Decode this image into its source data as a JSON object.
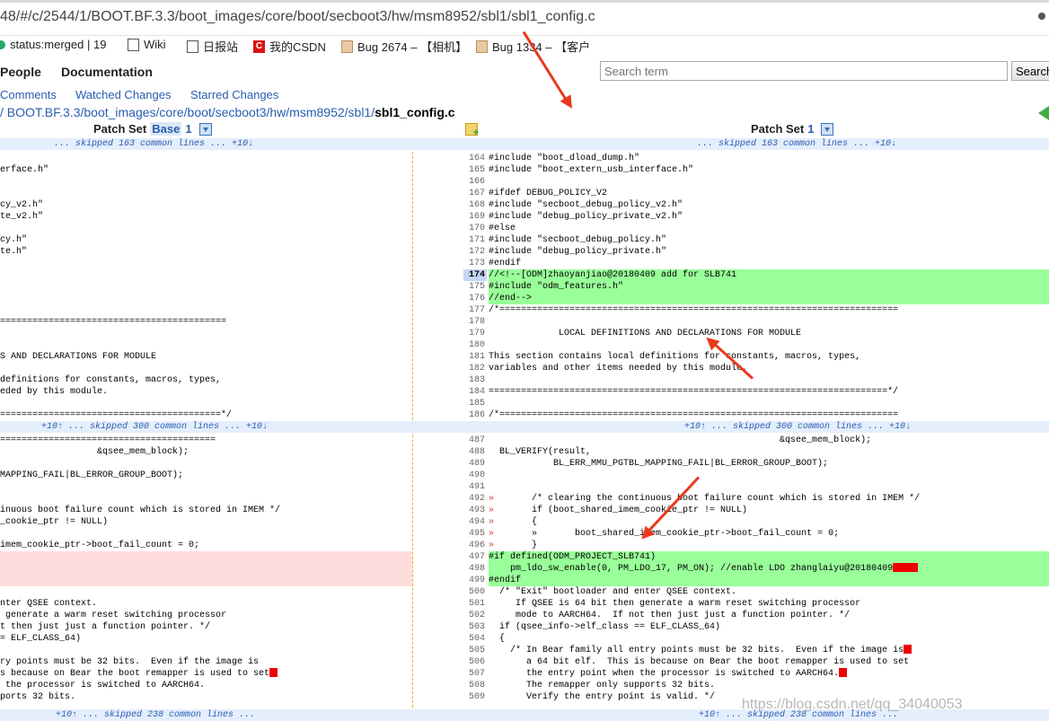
{
  "address_bar": {
    "url": "48/#/c/2544/1/BOOT.BF.3.3/boot_images/core/boot/secboot3/hw/msm8952/sbl1/sbl1_config.c"
  },
  "bookmarks": [
    {
      "label": "status:merged | 19",
      "icon": "gerrit-icon"
    },
    {
      "label": "Wiki",
      "icon": "page-icon"
    },
    {
      "label": "日报站",
      "icon": "page-icon"
    },
    {
      "label": "我的CSDN",
      "icon": "csdn-icon"
    },
    {
      "label": "Bug 2674 – 【相机】",
      "icon": "bugzilla-icon"
    },
    {
      "label": "Bug 1334 – 【客户",
      "icon": "bugzilla-icon"
    }
  ],
  "header": {
    "nav": [
      "People",
      "Documentation"
    ],
    "search_placeholder": "Search term",
    "search_button": "Search",
    "subnav": [
      "Comments",
      "Watched Changes",
      "Starred Changes"
    ],
    "path_prefix": "/ BOOT.BF.3.3/boot_images/core/boot/secboot3/hw/msm8952/sbl1/",
    "path_file": "sbl1_config.c"
  },
  "patchsets": {
    "left_label": "Patch Set",
    "left_base": "Base",
    "left_num": "1",
    "right_label": "Patch Set",
    "right_num": "1"
  },
  "skips": [
    {
      "left": "... skipped 163 common lines ... +10↓",
      "right": "... skipped 163 common lines ... +10↓"
    },
    {
      "left": "+10↑ ... skipped 300 common lines ... +10↓",
      "right": "+10↑ ... skipped 300 common lines ... +10↓"
    },
    {
      "left": "+10↑ ... skipped 238 common lines ...",
      "right": "+10↑ ... skipped 238 common lines ..."
    }
  ],
  "left_lines": [
    "",
    "erface.h\"",
    "",
    "",
    "cy_v2.h\"",
    "te_v2.h\"",
    "",
    "cy.h\"",
    "te.h\"",
    "",
    "",
    "",
    "",
    "",
    "==========================================",
    "",
    "",
    "S AND DECLARATIONS FOR MODULE",
    "",
    "definitions for constants, macros, types,",
    "eded by this module.",
    "",
    "=========================================*/",
    "",
    "========================================",
    "                  &qsee_mem_block);",
    "",
    "MAPPING_FAIL|BL_ERROR_GROUP_BOOT);",
    "",
    "",
    "inuous boot failure count which is stored in IMEM */",
    "_cookie_ptr != NULL)",
    "",
    "imem_cookie_ptr->boot_fail_count = 0;",
    "",
    "",
    "",
    "",
    "nter QSEE context.",
    " generate a warm reset switching processor",
    "t then just just a function pointer. */",
    "= ELF_CLASS_64)",
    "",
    "ry points must be 32 bits.  Even if the image is",
    "s because on Bear the boot remapper is used to set",
    " the processor is switched to AARCH64.",
    "ports 32 bits.",
    "t is valid. */"
  ],
  "right_block1": [
    {
      "n": "164",
      "t": "#include \"boot_dload_dump.h\""
    },
    {
      "n": "165",
      "t": "#include \"boot_extern_usb_interface.h\""
    },
    {
      "n": "166",
      "t": ""
    },
    {
      "n": "167",
      "t": "#ifdef DEBUG_POLICY_V2"
    },
    {
      "n": "168",
      "t": "#include \"secboot_debug_policy_v2.h\""
    },
    {
      "n": "169",
      "t": "#include \"debug_policy_private_v2.h\""
    },
    {
      "n": "170",
      "t": "#else"
    },
    {
      "n": "171",
      "t": "#include \"secboot_debug_policy.h\""
    },
    {
      "n": "172",
      "t": "#include \"debug_policy_private.h\""
    },
    {
      "n": "173",
      "t": "#endif"
    },
    {
      "n": "174",
      "t": "//<!--[ODM]zhaoyanjiao@20180409 add for SLB741"
    },
    {
      "n": "175",
      "t": "#include \"odm_features.h\""
    },
    {
      "n": "176",
      "t": "//end-->"
    },
    {
      "n": "177",
      "t": "/*=========================================================================="
    },
    {
      "n": "178",
      "t": ""
    },
    {
      "n": "179",
      "t": "             LOCAL DEFINITIONS AND DECLARATIONS FOR MODULE"
    },
    {
      "n": "180",
      "t": ""
    },
    {
      "n": "181",
      "t": "This section contains local definitions for constants, macros, types,"
    },
    {
      "n": "182",
      "t": "variables and other items needed by this module."
    },
    {
      "n": "183",
      "t": ""
    },
    {
      "n": "184",
      "t": "==========================================================================*/"
    },
    {
      "n": "185",
      "t": ""
    },
    {
      "n": "186",
      "t": "/*=========================================================================="
    }
  ],
  "right_block2": [
    {
      "n": "487",
      "t": "                                                      &qsee_mem_block);"
    },
    {
      "n": "488",
      "t": "  BL_VERIFY(result,"
    },
    {
      "n": "489",
      "t": "            BL_ERR_MMU_PGTBL_MAPPING_FAIL|BL_ERROR_GROUP_BOOT);"
    },
    {
      "n": "490",
      "t": ""
    },
    {
      "n": "491",
      "t": ""
    },
    {
      "n": "492",
      "t": "»       /* clearing the continuous boot failure count which is stored in IMEM */"
    },
    {
      "n": "493",
      "t": "»       if (boot_shared_imem_cookie_ptr != NULL)"
    },
    {
      "n": "494",
      "t": "»       {"
    },
    {
      "n": "495",
      "t": "»       »       boot_shared_imem_cookie_ptr->boot_fail_count = 0;"
    },
    {
      "n": "496",
      "t": "»       }"
    },
    {
      "n": "497",
      "t": "#if defined(ODM_PROJECT_SLB741)"
    },
    {
      "n": "498",
      "t": "    pm_ldo_sw_enable(0, PM_LDO_17, PM_ON); //enable LDO zhanglaiyu@20180409"
    },
    {
      "n": "499",
      "t": "#endif"
    },
    {
      "n": "500",
      "t": "  /* \"Exit\" bootloader and enter QSEE context."
    },
    {
      "n": "501",
      "t": "     If QSEE is 64 bit then generate a warm reset switching processor"
    },
    {
      "n": "502",
      "t": "     mode to AARCH64.  If not then just just a function pointer. */"
    },
    {
      "n": "503",
      "t": "  if (qsee_info->elf_class == ELF_CLASS_64)"
    },
    {
      "n": "504",
      "t": "  {"
    },
    {
      "n": "505",
      "t": "    /* In Bear family all entry points must be 32 bits.  Even if the image is"
    },
    {
      "n": "506",
      "t": "       a 64 bit elf.  This is because on Bear the boot remapper is used to set"
    },
    {
      "n": "507",
      "t": "       the entry point when the processor is switched to AARCH64."
    },
    {
      "n": "508",
      "t": "       The remapper only supports 32 bits."
    },
    {
      "n": "509",
      "t": "       Verify the entry point is valid. */"
    }
  ],
  "watermark": "https://blog.csdn.net/qq_34040053"
}
